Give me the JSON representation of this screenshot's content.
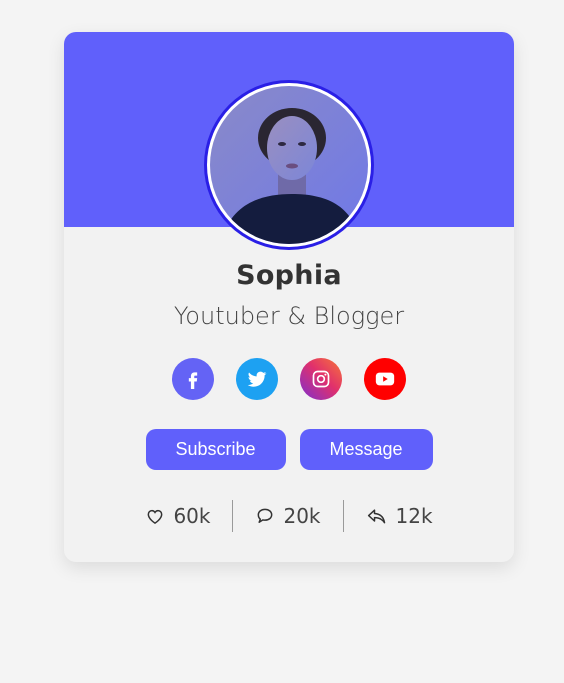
{
  "profile": {
    "name": "Sophia",
    "role": "Youtuber & Blogger",
    "avatar_icon": "profile-photo"
  },
  "socials": [
    {
      "name": "facebook",
      "icon": "facebook-icon",
      "color": "#6463f5"
    },
    {
      "name": "twitter",
      "icon": "twitter-icon",
      "color": "#1da1f2"
    },
    {
      "name": "instagram",
      "icon": "instagram-icon",
      "color": "#e1306c"
    },
    {
      "name": "youtube",
      "icon": "youtube-icon",
      "color": "#ff0000"
    }
  ],
  "actions": {
    "subscribe_label": "Subscribe",
    "message_label": "Message"
  },
  "stats": {
    "likes": "60k",
    "comments": "20k",
    "shares": "12k"
  },
  "colors": {
    "accent": "#6060fb",
    "background": "#f4f4f4",
    "card": "#f2f2f2"
  }
}
